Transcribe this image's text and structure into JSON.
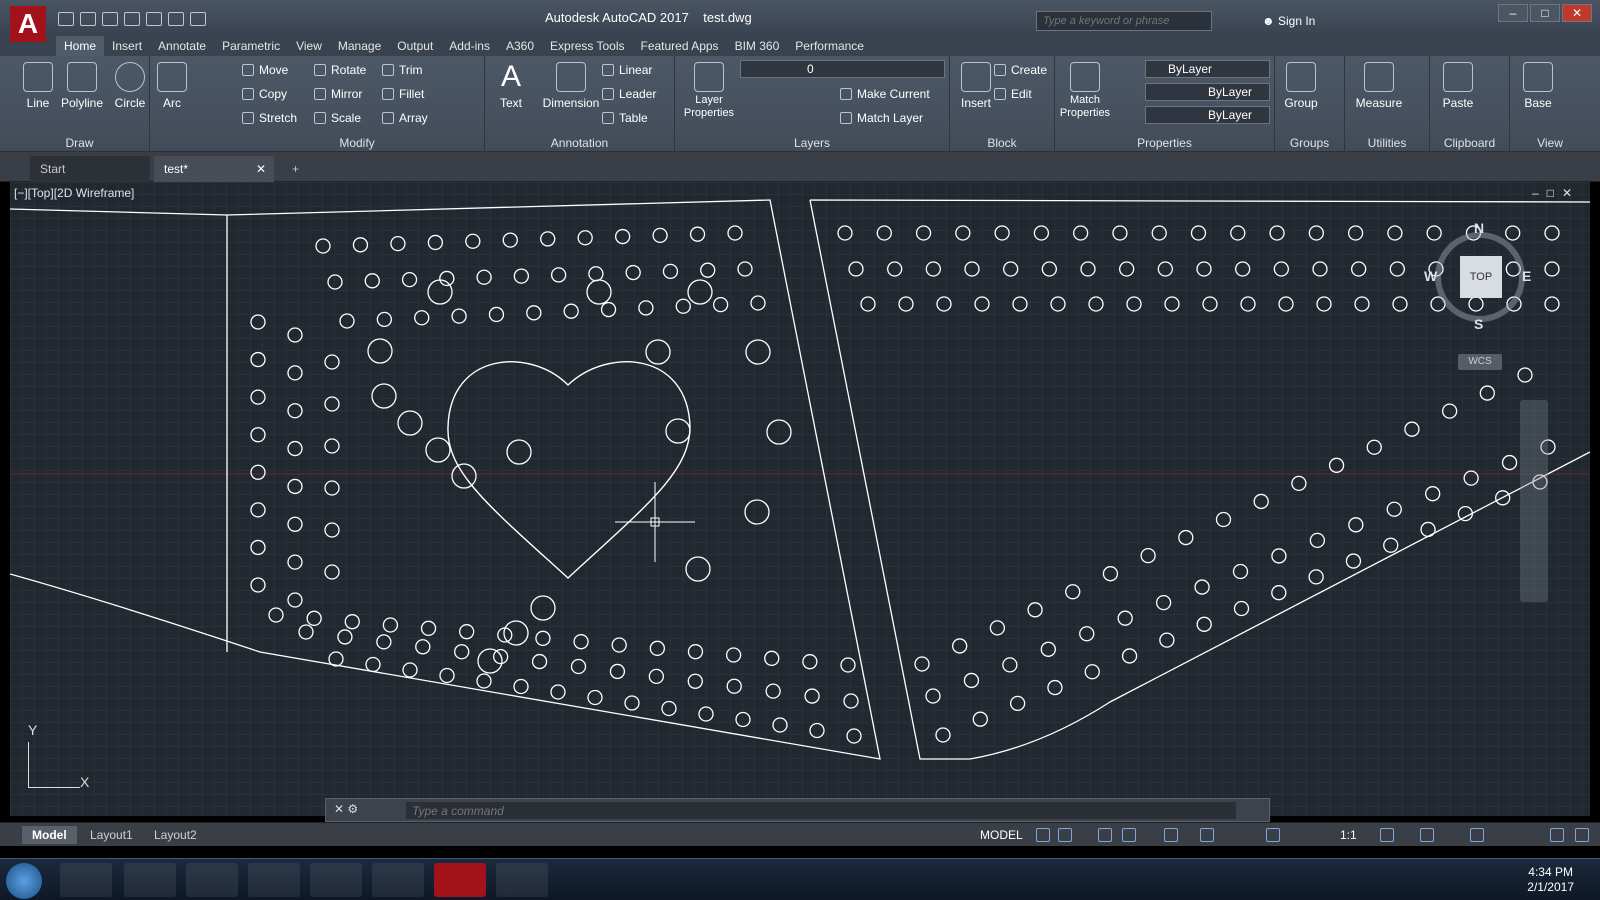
{
  "app": {
    "logo": "A",
    "title": "Autodesk AutoCAD 2017    test.dwg"
  },
  "search": {
    "placeholder": "Type a keyword or phrase"
  },
  "signin": "Sign In",
  "tabs": [
    "Home",
    "Insert",
    "Annotate",
    "Parametric",
    "View",
    "Manage",
    "Output",
    "Add-ins",
    "A360",
    "Express Tools",
    "Featured Apps",
    "BIM 360",
    "Performance"
  ],
  "ribbon": {
    "draw": {
      "title": "Draw",
      "line": "Line",
      "polyline": "Polyline",
      "circle": "Circle",
      "arc": "Arc"
    },
    "modify": {
      "title": "Modify",
      "move": "Move",
      "rotate": "Rotate",
      "trim": "Trim",
      "copy": "Copy",
      "mirror": "Mirror",
      "fillet": "Fillet",
      "stretch": "Stretch",
      "scale": "Scale",
      "array": "Array"
    },
    "annotation": {
      "title": "Annotation",
      "text": "Text",
      "dimension": "Dimension",
      "linear": "Linear",
      "leader": "Leader",
      "table": "Table"
    },
    "layers": {
      "title": "Layers",
      "layer_properties": "Layer Properties",
      "layer_value": "0",
      "make_current": "Make Current",
      "match_layer": "Match Layer"
    },
    "block": {
      "title": "Block",
      "insert": "Insert",
      "create": "Create",
      "edit": "Edit"
    },
    "properties": {
      "title": "Properties",
      "match": "Match Properties",
      "bylayer1": "ByLayer",
      "bylayer2": "ByLayer",
      "bylayer3": "ByLayer"
    },
    "groups": {
      "title": "Groups",
      "group": "Group"
    },
    "utilities": {
      "title": "Utilities",
      "measure": "Measure"
    },
    "clipboard": {
      "title": "Clipboard",
      "paste": "Paste"
    },
    "view": {
      "title": "View",
      "base": "Base"
    }
  },
  "doc_tabs": {
    "start": "Start",
    "test": "test*"
  },
  "viewport": {
    "label": "[−][Top][2D Wireframe]",
    "compass_n": "N",
    "compass_s": "S",
    "compass_e": "E",
    "compass_w": "W",
    "cube_top": "TOP",
    "wcs": "WCS",
    "ucs_y": "Y",
    "ucs_x": "X"
  },
  "command": {
    "placeholder": "Type a command"
  },
  "layouts": [
    "Model",
    "Layout1",
    "Layout2"
  ],
  "status": {
    "model": "MODEL",
    "scale": "1:1"
  },
  "clock": {
    "time": "4:34 PM",
    "date": "2/1/2017"
  }
}
